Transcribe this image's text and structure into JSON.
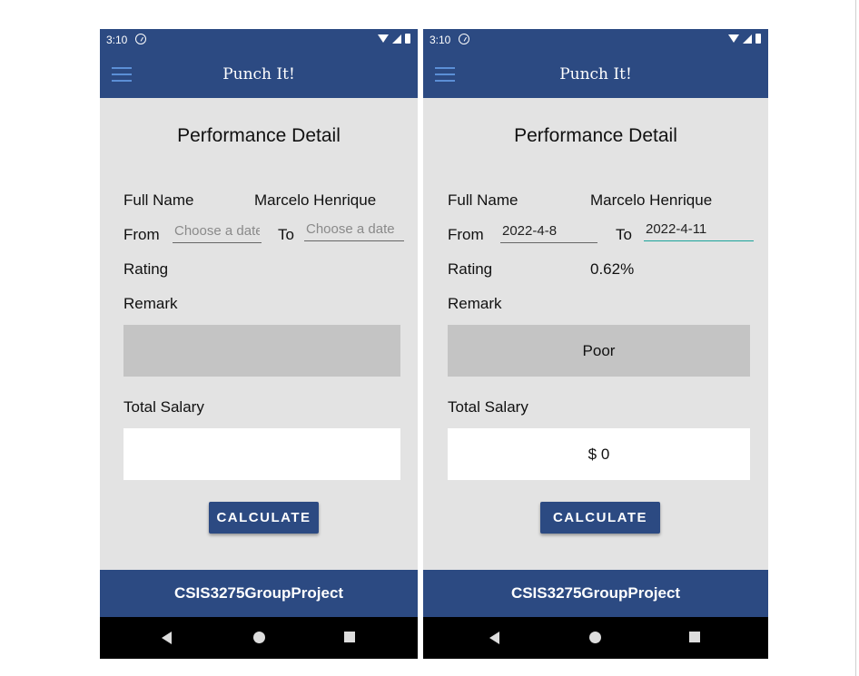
{
  "colors": {
    "primary": "#2c4a82",
    "background": "#e3e3e3",
    "remark_box": "#c4c4c4",
    "focus_underline": "#1aa39a"
  },
  "phones": [
    {
      "status": {
        "time": "3:10"
      },
      "appbar": {
        "title": "Punch It!"
      },
      "page_title": "Performance Detail",
      "full_name_label": "Full Name",
      "full_name_value": "Marcelo Henrique",
      "from_label": "From",
      "from_value": "",
      "from_placeholder": "Choose a date",
      "to_label": "To",
      "to_value": "",
      "to_placeholder": "Choose a date",
      "rating_label": "Rating",
      "rating_value": "",
      "remark_label": "Remark",
      "remark_value": "",
      "total_salary_label": "Total Salary",
      "total_salary_value": "",
      "calculate_label": "CALCULATE",
      "footer": "CSIS3275GroupProject"
    },
    {
      "status": {
        "time": "3:10"
      },
      "appbar": {
        "title": "Punch It!"
      },
      "page_title": "Performance Detail",
      "full_name_label": "Full Name",
      "full_name_value": "Marcelo Henrique",
      "from_label": "From",
      "from_value": "2022-4-8",
      "from_placeholder": "",
      "to_label": "To",
      "to_value": "2022-4-11",
      "to_placeholder": "",
      "rating_label": "Rating",
      "rating_value": "0.62%",
      "remark_label": "Remark",
      "remark_value": "Poor",
      "total_salary_label": "Total Salary",
      "total_salary_value": "$ 0",
      "calculate_label": "CALCULATE",
      "footer": "CSIS3275GroupProject"
    }
  ]
}
